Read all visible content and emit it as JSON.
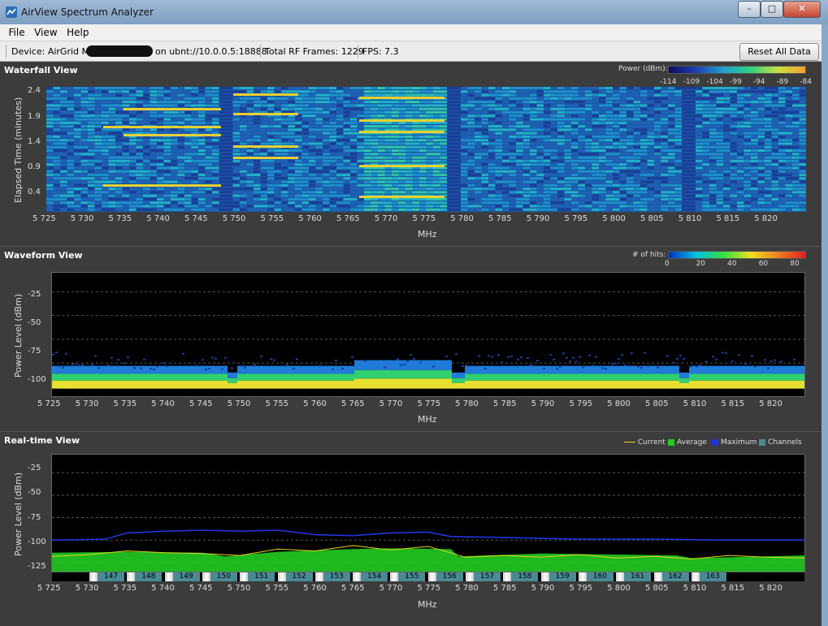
{
  "window": {
    "title": "AirView Spectrum Analyzer",
    "buttons": {
      "minimize": "–",
      "maximize": "□",
      "close": "✕"
    }
  },
  "menu": [
    "File",
    "View",
    "Help"
  ],
  "toolbar": {
    "device_label": "Device: AirGrid M5",
    "device_address": "on ubnt://10.0.0.5:18888",
    "rf_frames": "Total RF Frames: 1229",
    "fps": "FPS: 7.3",
    "reset_label": "Reset All Data"
  },
  "waterfall": {
    "title": "Waterfall View",
    "ylabel": "Elapsed Time (minutes)",
    "xlabel": "MHz",
    "yticks": [
      "2.4",
      "1.9",
      "1.4",
      "0.9",
      "0.4"
    ],
    "legend_title": "Power (dBm):",
    "legend_values": [
      "-114",
      "-109",
      "-104",
      "-99",
      "-94",
      "-89",
      "-84"
    ]
  },
  "waveform": {
    "title": "Waveform View",
    "ylabel": "Power Level (dBm)",
    "xlabel": "MHz",
    "yticks": [
      "-25",
      "-50",
      "-75",
      "-100"
    ],
    "legend_title": "# of hits:",
    "legend_values": [
      "0",
      "20",
      "40",
      "60",
      "80"
    ]
  },
  "realtime": {
    "title": "Real-time View",
    "ylabel": "Power Level (dBm)",
    "xlabel": "MHz",
    "yticks": [
      "-25",
      "-50",
      "-75",
      "-100",
      "-125"
    ],
    "legend": [
      {
        "label": "Current",
        "color": "#e6d21e"
      },
      {
        "label": "Average",
        "color": "#22cc22"
      },
      {
        "label": "Maximum",
        "color": "#2233dd"
      },
      {
        "label": "Channels",
        "color": "#4a8a95"
      }
    ],
    "channels": [
      "147",
      "148",
      "149",
      "150",
      "151",
      "152",
      "153",
      "154",
      "155",
      "156",
      "157",
      "158",
      "159",
      "160",
      "161",
      "162",
      "163"
    ]
  },
  "chart_data": {
    "type": "line",
    "x_ticks": [
      "5 725",
      "5 730",
      "5 735",
      "5 740",
      "5 745",
      "5 750",
      "5 755",
      "5 760",
      "5 765",
      "5 770",
      "5 775",
      "5 780",
      "5 785",
      "5 790",
      "5 795",
      "5 800",
      "5 805",
      "5 810",
      "5 815",
      "5 820"
    ],
    "xlim": [
      5725,
      5825
    ],
    "ylim": [
      -135,
      -5
    ],
    "series": [
      {
        "name": "Maximum",
        "color": "#2233dd",
        "x": [
          5725,
          5732,
          5735,
          5740,
          5745,
          5750,
          5755,
          5760,
          5765,
          5770,
          5775,
          5778,
          5785,
          5795,
          5805,
          5815,
          5825
        ],
        "y": [
          -100,
          -99,
          -92,
          -90,
          -89,
          -90,
          -89,
          -94,
          -95,
          -92,
          -91,
          -96,
          -97,
          -99,
          -99,
          -100,
          -100
        ]
      },
      {
        "name": "Average",
        "color": "#22cc22",
        "x": [
          5725,
          5735,
          5745,
          5748,
          5755,
          5765,
          5770,
          5778,
          5779,
          5790,
          5800,
          5808,
          5810,
          5825
        ],
        "y": [
          -114,
          -113,
          -114,
          -118,
          -113,
          -110,
          -109,
          -110,
          -118,
          -115,
          -116,
          -117,
          -120,
          -117
        ]
      },
      {
        "name": "Current",
        "color": "#e6d21e",
        "x": [
          5725,
          5730,
          5735,
          5740,
          5745,
          5750,
          5755,
          5760,
          5765,
          5770,
          5775,
          5780,
          5785,
          5790,
          5795,
          5800,
          5805,
          5810,
          5815,
          5820,
          5825
        ],
        "y": [
          -118,
          -116,
          -112,
          -114,
          -115,
          -117,
          -110,
          -112,
          -106,
          -111,
          -107,
          -119,
          -117,
          -119,
          -116,
          -120,
          -118,
          -121,
          -117,
          -119,
          -120
        ]
      }
    ]
  }
}
